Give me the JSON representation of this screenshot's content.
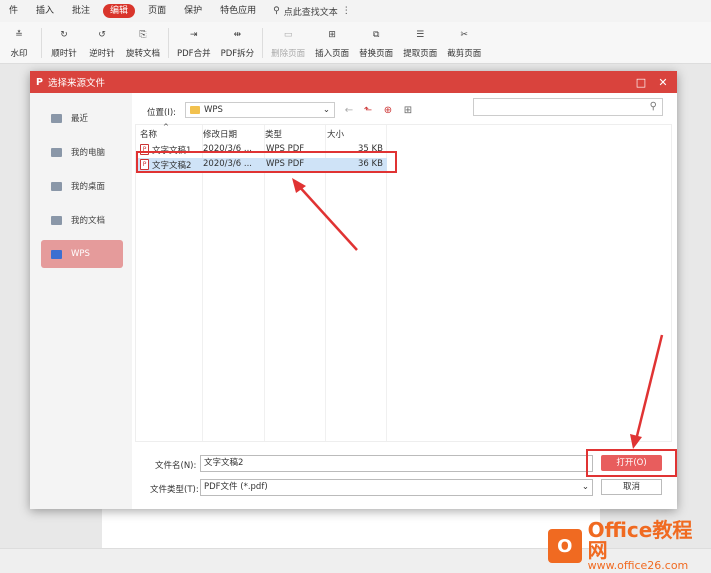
{
  "menubar": {
    "items": [
      "件",
      "插入",
      "批注",
      "编辑",
      "页面",
      "保护",
      "特色应用"
    ],
    "active": "编辑",
    "search": "点此查找文本"
  },
  "toolbar": {
    "items": [
      {
        "label": "水印",
        "icon": "watermark-icon",
        "glyph": "≛"
      },
      {
        "label": "顺时针",
        "icon": "rotate-cw-icon",
        "glyph": "↻"
      },
      {
        "label": "逆时针",
        "icon": "rotate-ccw-icon",
        "glyph": "↺"
      },
      {
        "label": "旋转文档",
        "icon": "rotate-doc-icon",
        "glyph": "⎘"
      },
      {
        "label": "PDF合并",
        "icon": "merge-icon",
        "glyph": "⇥"
      },
      {
        "label": "PDF拆分",
        "icon": "split-icon",
        "glyph": "⇹"
      },
      {
        "label": "删除页面",
        "icon": "delete-page-icon",
        "glyph": "▭",
        "disabled": true
      },
      {
        "label": "插入页面",
        "icon": "insert-page-icon",
        "glyph": "⊞"
      },
      {
        "label": "替换页面",
        "icon": "replace-page-icon",
        "glyph": "⧉"
      },
      {
        "label": "提取页面",
        "icon": "extract-page-icon",
        "glyph": "☰"
      },
      {
        "label": "截剪页面",
        "icon": "crop-page-icon",
        "glyph": "✂"
      }
    ]
  },
  "dialog": {
    "title": "选择来源文件",
    "places": [
      "最近",
      "我的电脑",
      "我的桌面",
      "我的文档",
      "WPS"
    ],
    "selected_place": "WPS",
    "location_label": "位置(I):",
    "location_value": "WPS",
    "columns": {
      "name": "名称",
      "date": "修改日期",
      "type": "类型",
      "size": "大小"
    },
    "files": [
      {
        "name": "文字文稿1",
        "date": "2020/3/6 ...",
        "type": "WPS PDF",
        "size": "35 KB"
      },
      {
        "name": "文字文稿2",
        "date": "2020/3/6 ...",
        "type": "WPS PDF",
        "size": "36 KB"
      }
    ],
    "filename_label": "文件名(N):",
    "filename_value": "文字文稿2",
    "filetype_label": "文件类型(T):",
    "filetype_value": "PDF文件 (*.pdf)",
    "open_label": "打开(O)",
    "cancel_label": "取消"
  },
  "watermark": {
    "brand": "Office教程网",
    "url": "www.office26.com",
    "logo_letter": "O"
  },
  "colors": {
    "accent": "#d9433d",
    "annotation": "#e03333",
    "selected_row": "#cfe3f7"
  }
}
